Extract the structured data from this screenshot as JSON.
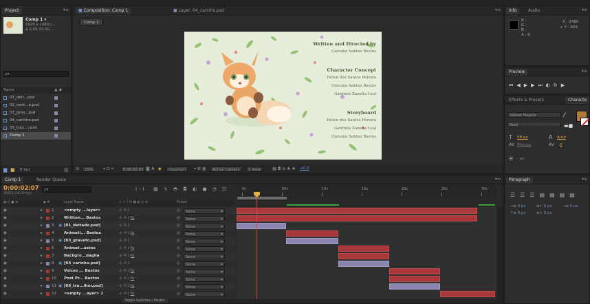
{
  "project": {
    "tab_label": "Project",
    "comp_name": "Comp 1 ▾",
    "comp_info1": "1920 x 1080 (...",
    "comp_info2": "Δ 0;00;32;00,...",
    "search_placeholder": "ρ▾",
    "col_name": "Name",
    "items": [
      {
        "label": "01_deit...psd",
        "color": "#8a86b0"
      },
      {
        "label": "02_cent...a.psd",
        "color": "#8a86b0"
      },
      {
        "label": "03_grav...psd",
        "color": "#8a86b0"
      },
      {
        "label": "04_carinho.psd",
        "color": "#8a86b0"
      },
      {
        "label": "05_traz...r.psd",
        "color": "#8a86b0"
      },
      {
        "label": "Comp 1",
        "color": "#8a86b0"
      }
    ],
    "bpc": "8 bpc"
  },
  "composition": {
    "tab_label": "Composition: Comp 1",
    "layer_tab": "Layer: 04_carinho.psd",
    "comp_button": "Comp 1",
    "zoom": "25%",
    "timecode": "0:00:02:07",
    "quality": "(Quarter)",
    "camera": "Active Camera",
    "views": "1 View",
    "exposure": "+0,0"
  },
  "poster": {
    "written_heading": "Written and Directed by",
    "written_name": "Giovana Sabino Bastos",
    "concept_heading": "Character Concept",
    "concept_names": [
      "Helen dos Santos Pereira",
      "Giovana Sabino Bastos",
      "Gabriela Zanella Leal"
    ],
    "story_heading": "Storyboard",
    "story_names": [
      "Helen dos Santos Pereira",
      "Gabriela Zanella Leal",
      "Giovana Sabino Bastos"
    ]
  },
  "info": {
    "tab_info": "Info",
    "tab_audio": "Audio",
    "r": "R :",
    "g": "G :",
    "b": "B :",
    "a": "A : 0",
    "x": "X : 2480",
    "y": "+ Y : 928"
  },
  "preview": {
    "tab_label": "Preview"
  },
  "character": {
    "tab_effects": "Effects & Presets",
    "tab_char": "Characte",
    "font": "Sakkal Majalla",
    "style": "Bold",
    "size": "58 px",
    "leading": "Auto",
    "kerning": "Metrics",
    "tracking": "0",
    "stroke_unit": "- px"
  },
  "paragraph": {
    "tab_label": "Paragraph",
    "indent_left": "0 px",
    "indent_right": "0 px",
    "indent_first": "0 px",
    "space_before": "0 px",
    "space_after": "0 px"
  },
  "timeline": {
    "tab_comp": "Comp 1",
    "tab_render": "Render Queue",
    "timecode": "0:00:02:07",
    "fps": "00055 (24.00 fps)",
    "col_layer_name": "Layer Name",
    "col_parent": "Parent",
    "ruler": [
      "0s",
      "05s",
      "10s",
      "15s",
      "20s",
      "25s",
      "30s"
    ],
    "toggle_label": "Toggle Switches / Modes",
    "layers": [
      {
        "num": "1",
        "name": "<empty ...layer>",
        "color": "#a8383a",
        "parent": "None",
        "fx": false
      },
      {
        "num": "2",
        "name": "Written... Bastos",
        "color": "#a8383a",
        "parent": "None",
        "fx": true
      },
      {
        "num": "3",
        "name": "[01_deitado.psd]",
        "color": "#8a86b0",
        "parent": "None",
        "fx": false
      },
      {
        "num": "4",
        "name": "Animati... Bastos",
        "color": "#a8383a",
        "parent": "None",
        "fx": true
      },
      {
        "num": "5",
        "name": "[03_graveto.psd]",
        "color": "#8a86b0",
        "parent": "None",
        "fx": false
      },
      {
        "num": "6",
        "name": "Animat...astos",
        "color": "#a8383a",
        "parent": "None",
        "fx": true
      },
      {
        "num": "7",
        "name": "Backgro...daglia",
        "color": "#a8383a",
        "parent": "None",
        "fx": true
      },
      {
        "num": "8",
        "name": "[04_carinho.psd]",
        "color": "#8a86b0",
        "parent": "None",
        "fx": false
      },
      {
        "num": "9",
        "name": "Voices ... Bastos",
        "color": "#a8383a",
        "parent": "None",
        "fx": true
      },
      {
        "num": "10",
        "name": "Post Pr... Bastos",
        "color": "#a8383a",
        "parent": "None",
        "fx": true
      },
      {
        "num": "11",
        "name": "[05_tra...lhor.psd]",
        "color": "#8a86b0",
        "parent": "None",
        "fx": true
      },
      {
        "num": "12",
        "name": "<empty ...ayer> 2",
        "color": "#a8383a",
        "parent": "None",
        "fx": true
      }
    ]
  }
}
